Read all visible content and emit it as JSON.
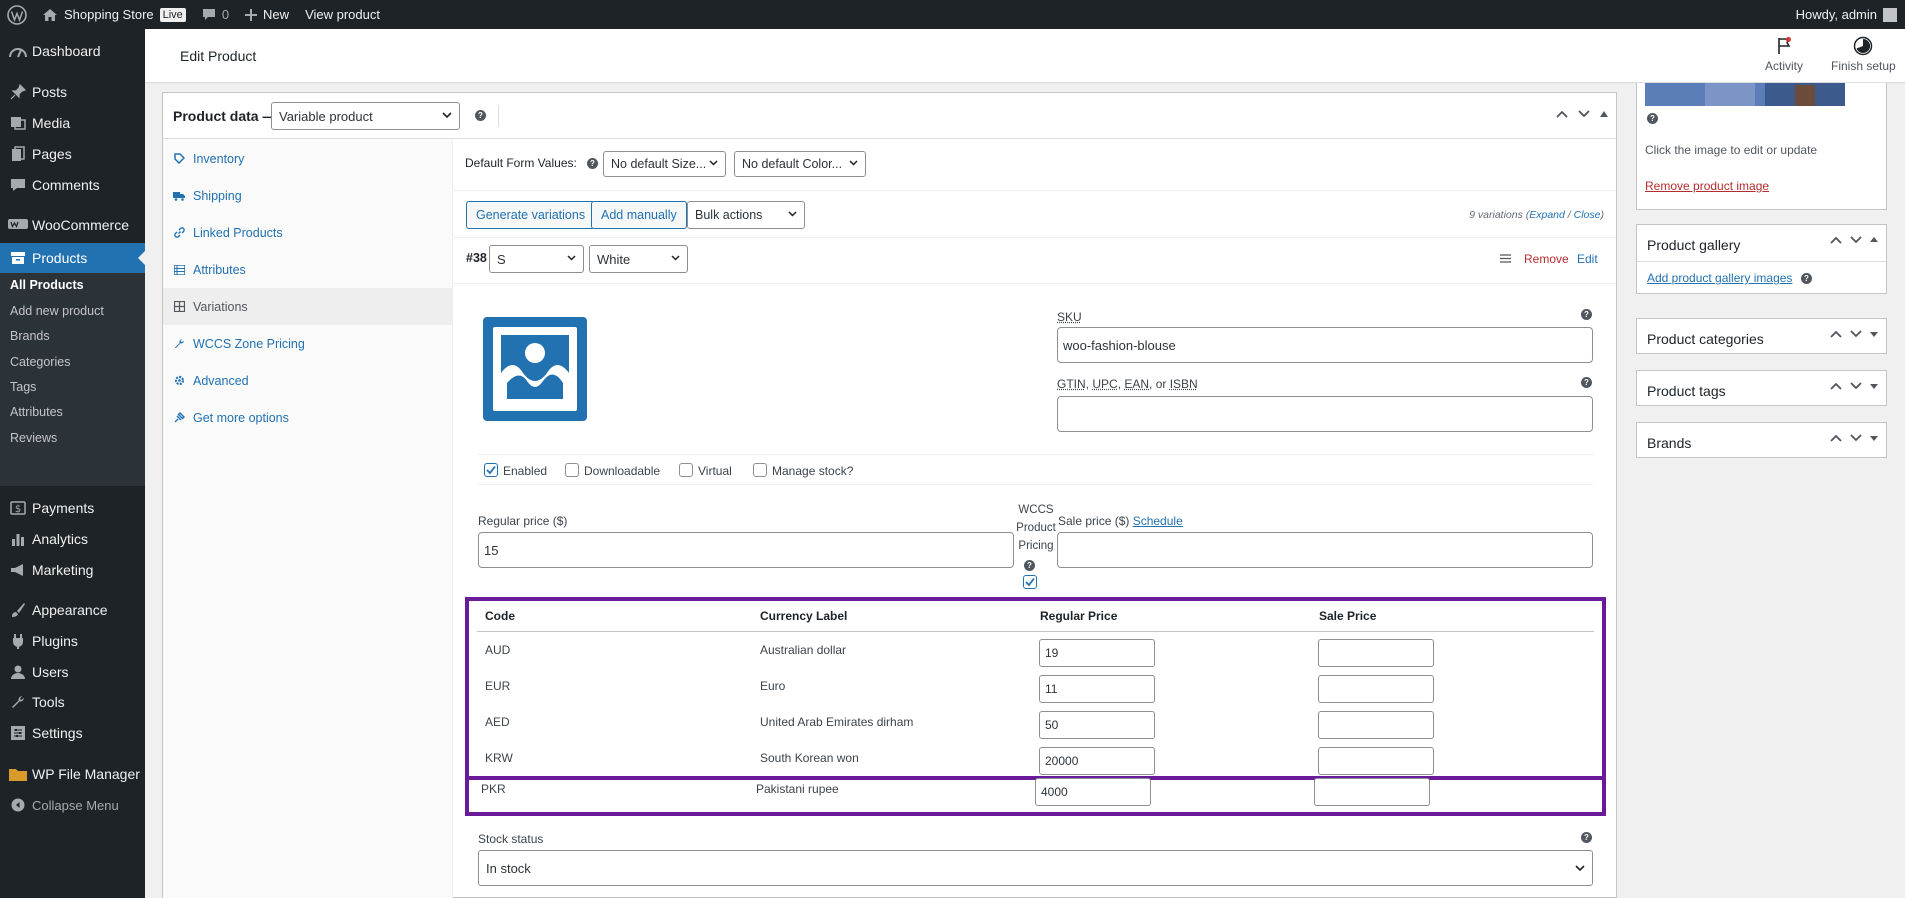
{
  "adminbar": {
    "site_name": "Shopping Store",
    "live_badge": "Live",
    "comments_count": "0",
    "new_label": "New",
    "view_product_label": "View product",
    "howdy": "Howdy, admin"
  },
  "sidebar": {
    "dashboard": "Dashboard",
    "posts": "Posts",
    "media": "Media",
    "pages": "Pages",
    "comments": "Comments",
    "woocommerce": "WooCommerce",
    "products": "Products",
    "payments": "Payments",
    "analytics": "Analytics",
    "marketing": "Marketing",
    "appearance": "Appearance",
    "plugins": "Plugins",
    "users": "Users",
    "tools": "Tools",
    "settings": "Settings",
    "wp_file_manager": "WP File Manager",
    "collapse_menu": "Collapse Menu",
    "products_submenu": {
      "all_products": "All Products",
      "add_new_product": "Add new product",
      "brands": "Brands",
      "categories": "Categories",
      "tags": "Tags",
      "attributes": "Attributes",
      "reviews": "Reviews"
    }
  },
  "header": {
    "title": "Edit Product",
    "activity": "Activity",
    "finish_setup": "Finish setup"
  },
  "product_data": {
    "label": "Product data —",
    "type": "Variable product",
    "tabs": {
      "inventory": "Inventory",
      "shipping": "Shipping",
      "linked_products": "Linked Products",
      "attributes": "Attributes",
      "variations": "Variations",
      "wccs_zone_pricing": "WCCS Zone Pricing",
      "advanced": "Advanced",
      "get_more_options": "Get more options"
    },
    "default_form_values_label": "Default Form Values:",
    "default_size": "No default Size...",
    "default_color": "No default Color...",
    "generate_variations": "Generate variations",
    "add_manually": "Add manually",
    "bulk_actions": "Bulk actions",
    "variations_count": "9 variations (",
    "expand": "Expand",
    "sep": " / ",
    "close": "Close",
    "close_paren": ")"
  },
  "variation": {
    "id": "#38",
    "size": "S",
    "color": "White",
    "remove": "Remove",
    "edit": "Edit",
    "sku_label": "SKU",
    "sku_value": "woo-fashion-blouse",
    "gtin_label_1": "GTIN",
    "gtin_sep_1": ", ",
    "gtin_label_2": "UPC",
    "gtin_sep_2": ", ",
    "gtin_label_3": "EAN",
    "gtin_sep_3": ", or ",
    "gtin_label_4": "ISBN",
    "gtin_value": "",
    "enabled": "Enabled",
    "downloadable": "Downloadable",
    "virtual": "Virtual",
    "manage_stock": "Manage stock?",
    "regular_price_label": "Regular price ($)",
    "regular_price_value": "15",
    "wccs_line1": "WCCS",
    "wccs_line2": "Product",
    "wccs_line3": "Pricing",
    "sale_price_label": "Sale price ($) ",
    "schedule": "Schedule",
    "stock_status_label": "Stock status",
    "stock_status_value": "In stock",
    "enabled_checked": true,
    "wccs_checked": true
  },
  "currency_table": {
    "headers": [
      "Code",
      "Currency Label",
      "Regular Price",
      "Sale Price"
    ],
    "rows": [
      {
        "code": "AUD",
        "label": "Australian dollar",
        "regular": "19",
        "sale": ""
      },
      {
        "code": "EUR",
        "label": "Euro",
        "regular": "11",
        "sale": ""
      },
      {
        "code": "AED",
        "label": "United Arab Emirates dirham",
        "regular": "50",
        "sale": ""
      },
      {
        "code": "KRW",
        "label": "South Korean won",
        "regular": "20000",
        "sale": ""
      },
      {
        "code": "PKR",
        "label": "Pakistani rupee",
        "regular": "4000",
        "sale": ""
      }
    ],
    "highlight_color": "#6a1b9a"
  },
  "right_sidebar": {
    "image_hint": "Click the image to edit or update",
    "remove_image": "Remove product image",
    "gallery_title": "Product gallery",
    "add_gallery": "Add product gallery images",
    "categories_title": "Product categories",
    "tags_title": "Product tags",
    "brands_title": "Brands"
  },
  "colors": {
    "accent": "#2271b1",
    "admin_dark": "#1d2327",
    "remove_red": "#b32d2e"
  }
}
